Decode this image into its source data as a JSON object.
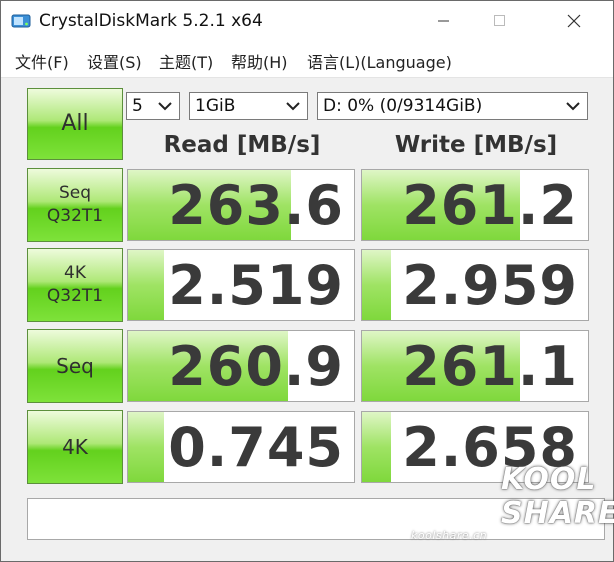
{
  "window": {
    "title": "CrystalDiskMark 5.2.1 x64"
  },
  "menu": {
    "items": [
      "文件(F)",
      "设置(S)",
      "主题(T)",
      "帮助(H)",
      "语言(L)(Language)"
    ]
  },
  "controls": {
    "all_label": "All",
    "count_value": "5",
    "size_value": "1GiB",
    "drive_value": "D: 0% (0/9314GiB)"
  },
  "columns": {
    "read_header": "Read [MB/s]",
    "write_header": "Write [MB/s]"
  },
  "tests": [
    {
      "label": "Seq\nQ32T1",
      "read": "263.6",
      "write": "261.2",
      "read_fill": 0.72,
      "write_fill": 0.7
    },
    {
      "label": "4K\nQ32T1",
      "read": "2.519",
      "write": "2.959",
      "read_fill": 0.16,
      "write_fill": 0.13
    },
    {
      "label": "Seq",
      "read": "260.9",
      "write": "261.1",
      "read_fill": 0.71,
      "write_fill": 0.7
    },
    {
      "label": "4K",
      "read": "0.745",
      "write": "2.658",
      "read_fill": 0.16,
      "write_fill": 0.13
    }
  ],
  "comment": {
    "value": ""
  },
  "watermark": {
    "url": "koolshare.cn",
    "logo_line1": "KOOL",
    "logo_line2": "SHARE"
  },
  "colors": {
    "button_green": "#63d11d",
    "bar_green": "#9fe364"
  }
}
